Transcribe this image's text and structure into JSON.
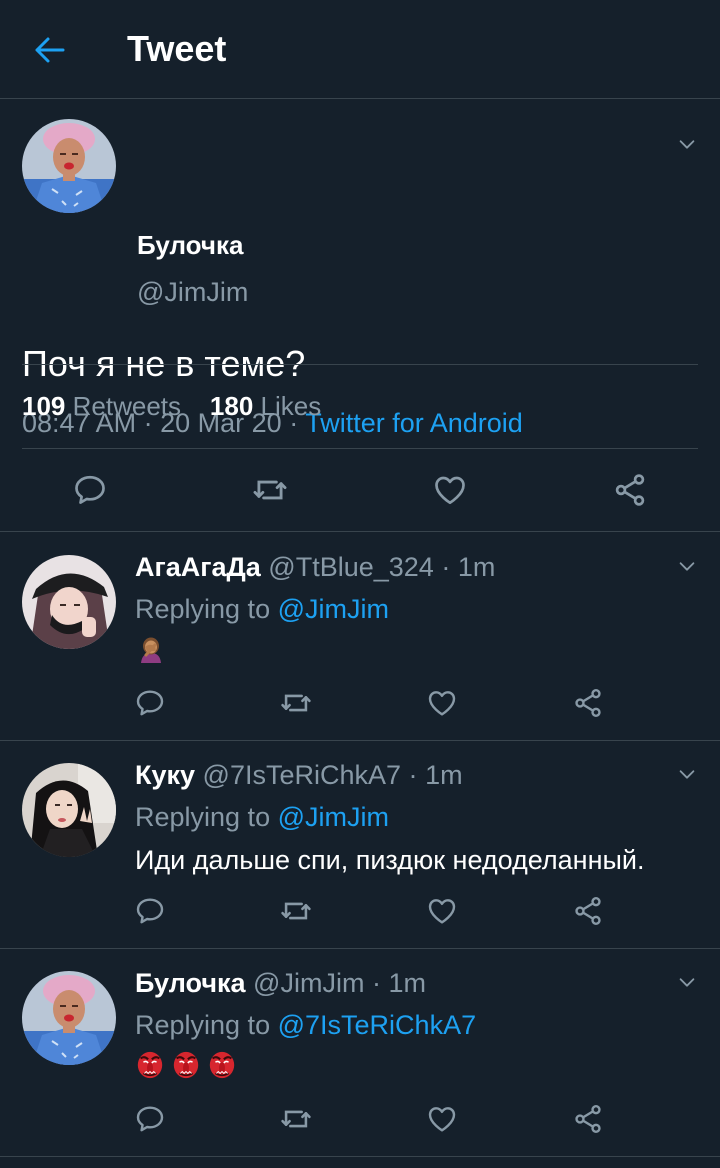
{
  "header": {
    "title": "Tweet"
  },
  "main_tweet": {
    "name": "Булочка",
    "handle": "@JimJim",
    "text": "Поч я не в теме?",
    "time": "08:47 AM",
    "date": "20 Mar 20",
    "source": "Twitter for Android",
    "retweets_count": "109",
    "retweets_label": "Retweets",
    "likes_count": "180",
    "likes_label": "Likes"
  },
  "replies": [
    {
      "name": "АгаАгаДа",
      "handle": "@TtBlue_324",
      "time": "1m",
      "replying_label": "Replying to",
      "replying_to": "@JimJim",
      "text": "",
      "emoji": [
        "woman-facepalming"
      ]
    },
    {
      "name": "Куку",
      "handle": "@7IsTeRiChkA7",
      "time": "1m",
      "replying_label": "Replying to",
      "replying_to": "@JimJim",
      "text": "Иди дальше спи, пиздюк недоделанный.",
      "emoji": []
    },
    {
      "name": "Булочка",
      "handle": "@JimJim",
      "time": "1m",
      "replying_label": "Replying to",
      "replying_to": "@7IsTeRiChkA7",
      "text": "",
      "emoji": [
        "tengu-mask",
        "tengu-mask",
        "tengu-mask"
      ]
    }
  ],
  "separator": "·",
  "colors": {
    "background": "#15202b",
    "divider": "#38444d",
    "accent": "#1da1f2",
    "muted": "#8899a6"
  }
}
